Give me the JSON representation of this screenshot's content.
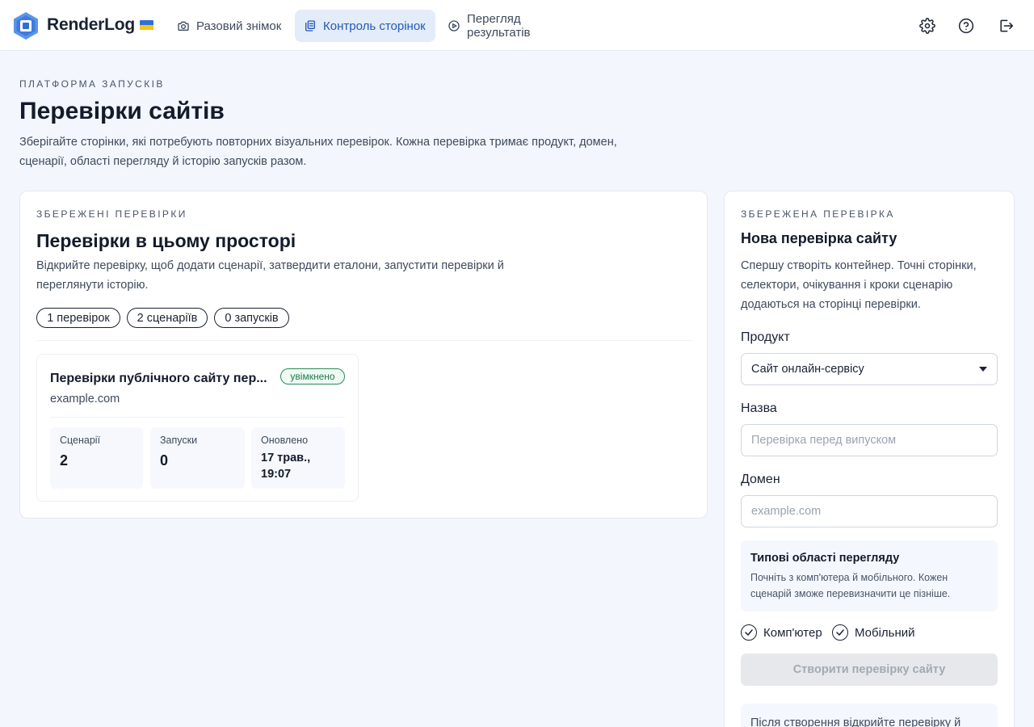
{
  "app": {
    "brand": "RenderLog",
    "flag_icon": "ukraine-flag-icon"
  },
  "nav": [
    {
      "label": "Разовий знімок",
      "icon": "camera-icon",
      "active": false
    },
    {
      "label": "Контроль сторінок",
      "icon": "pages-icon",
      "active": true
    },
    {
      "label": "Перегляд результатів",
      "icon": "play-circle-icon",
      "active": false
    }
  ],
  "toolbar_icons": [
    "gear-icon",
    "help-icon",
    "logout-icon"
  ],
  "header": {
    "eyebrow": "ПЛАТФОРМА ЗАПУСКІВ",
    "title": "Перевірки сайтів",
    "description": "Зберігайте сторінки, які потребують повторних візуальних перевірок. Кожна перевірка тримає продукт, домен, сценарії, області перегляду й історію запусків разом."
  },
  "saved_checks": {
    "eyebrow": "ЗБЕРЕЖЕНІ ПЕРЕВІРКИ",
    "title": "Перевірки в цьому просторі",
    "description": "Відкрийте перевірку, щоб додати сценарії, затвердити еталони, запустити перевірки й переглянути історію.",
    "pills": [
      "1 перевірок",
      "2 сценаріїв",
      "0 запусків"
    ],
    "items": [
      {
        "title": "Перевірки публічного сайту пер...",
        "status": "увімкнено",
        "domain": "example.com",
        "stats": [
          {
            "label": "Сценарії",
            "value": "2"
          },
          {
            "label": "Запуски",
            "value": "0"
          },
          {
            "label": "Оновлено",
            "value": "17 трав., 19:07"
          }
        ]
      }
    ]
  },
  "new_check": {
    "eyebrow": "ЗБЕРЕЖЕНА ПЕРЕВІРКА",
    "title": "Нова перевірка сайту",
    "description": "Спершу створіть контейнер. Точні сторінки, селектори, очікування і кроки сценарію додаються на сторінці перевірки.",
    "product_label": "Продукт",
    "product_value": "Сайт онлайн-сервісу",
    "name_label": "Назва",
    "name_placeholder": "Перевірка перед випуском",
    "domain_label": "Домен",
    "domain_placeholder": "example.com",
    "viewports_title": "Типові області перегляду",
    "viewports_desc": "Почніть з комп'ютера й мобільного. Кожен сценарій зможе перевизначити це пізніше.",
    "viewport_desktop": "Комп'ютер",
    "viewport_mobile": "Мобільний",
    "desktop_checked": true,
    "mobile_checked": true,
    "create_button": "Створити перевірку сайту",
    "after_note": "Після створення відкрийте перевірку й"
  },
  "colors": {
    "accent": "#2459b8",
    "active_nav_bg": "#e3ecf9",
    "success": "#1e7a4a",
    "page_bg": "#f3f6fc"
  }
}
